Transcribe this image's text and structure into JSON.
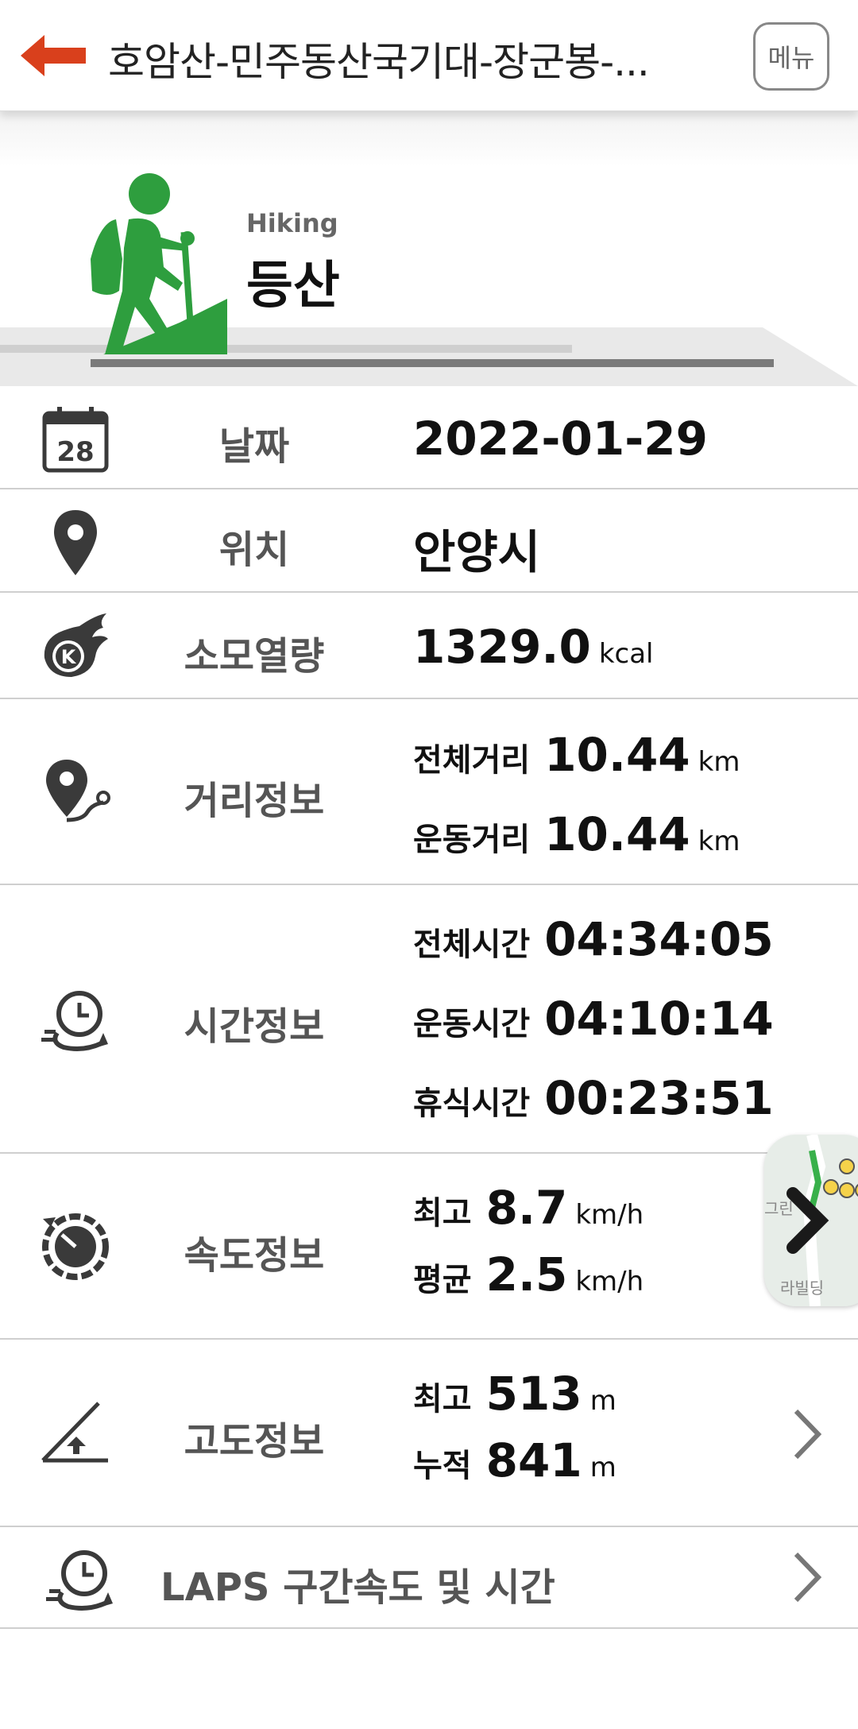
{
  "header": {
    "title": "호암산-민주동산국기대-장군봉-...",
    "menu_label": "메뉴"
  },
  "activity": {
    "subtitle": "Hiking",
    "title": "등산"
  },
  "rows": {
    "date": {
      "label": "날짜",
      "value": "2022-01-29",
      "icon_day": "28"
    },
    "location": {
      "label": "위치",
      "value": "안양시"
    },
    "calories": {
      "label": "소모열량",
      "value": "1329.0",
      "unit": "kcal"
    },
    "distance": {
      "label": "거리정보",
      "total_label": "전체거리",
      "total_value": "10.44",
      "total_unit": "km",
      "moving_label": "운동거리",
      "moving_value": "10.44",
      "moving_unit": "km"
    },
    "time": {
      "label": "시간정보",
      "total_label": "전체시간",
      "total_value": "04:34:05",
      "moving_label": "운동시간",
      "moving_value": "04:10:14",
      "rest_label": "휴식시간",
      "rest_value": "00:23:51"
    },
    "speed": {
      "label": "속도정보",
      "max_label": "최고",
      "max_value": "8.7",
      "max_unit": "km/h",
      "avg_label": "평균",
      "avg_value": "2.5",
      "avg_unit": "km/h"
    },
    "altitude": {
      "label": "고도정보",
      "max_label": "최고",
      "max_value": "513",
      "max_unit": "m",
      "cum_label": "누적",
      "cum_value": "841",
      "cum_unit": "m"
    },
    "laps": {
      "label": "LAPS 구간속도 및 시간"
    }
  },
  "map_thumb": {
    "text": "그린",
    "text2": "라빌딩"
  },
  "colors": {
    "accent": "#d9401c",
    "hiker_green": "#2e9e3e",
    "icon_dark": "#3a3a3a",
    "label_gray": "#555555"
  },
  "icons": {
    "back": "arrow-left-icon",
    "calendar": "calendar-icon",
    "location": "location-pin-icon",
    "calories": "calorie-flame-icon",
    "distance": "route-pin-icon",
    "time": "clock-icon",
    "speed": "speedometer-icon",
    "altitude": "elevation-icon",
    "laps": "clock-icon",
    "chevron": "chevron-right-icon",
    "hiker": "hiker-icon"
  }
}
